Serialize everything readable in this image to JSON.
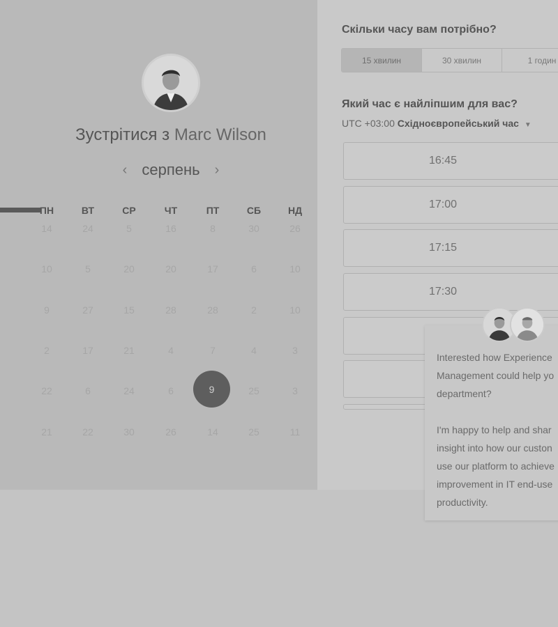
{
  "host": {
    "title_prefix": "Зустрітися з",
    "name": "Marc Wilson"
  },
  "calendar": {
    "month": "серпень",
    "prev_icon": "chevron-left-icon",
    "next_icon": "chevron-right-icon",
    "weekdays": [
      "ПН",
      "ВТ",
      "СР",
      "ЧТ",
      "ПТ",
      "СБ",
      "НД"
    ],
    "rows": [
      [
        "14",
        "24",
        "5",
        "16",
        "8",
        "30",
        "26"
      ],
      [
        "10",
        "5",
        "20",
        "20",
        "17",
        "6",
        "10"
      ],
      [
        "9",
        "27",
        "15",
        "28",
        "28",
        "2",
        "10"
      ],
      [
        "2",
        "17",
        "21",
        "4",
        "7",
        "4",
        "3"
      ],
      [
        "22",
        "6",
        "24",
        "6",
        "9",
        "25",
        "3"
      ],
      [
        "21",
        "22",
        "30",
        "26",
        "14",
        "25",
        "11"
      ]
    ],
    "selected_day": "9"
  },
  "duration": {
    "heading": "Скільки часу вам потрібно?",
    "options": [
      "15 хвилин",
      "30 хвилин",
      "1 годин"
    ]
  },
  "time": {
    "heading": "Який час є найліпшим для вас?",
    "tz_offset": "UTC +03:00",
    "tz_name": "Східноєвропейський час",
    "slots": [
      "16:45",
      "17:00",
      "17:15",
      "17:30",
      "",
      "",
      ""
    ]
  },
  "chat": {
    "message": "Interested how Experience\nManagement could help yo\ndepartment?\n\nI'm happy to help and shar\ninsight into how our custon\nuse our platform to achieve\nimprovement in IT end-use\nproductivity."
  }
}
